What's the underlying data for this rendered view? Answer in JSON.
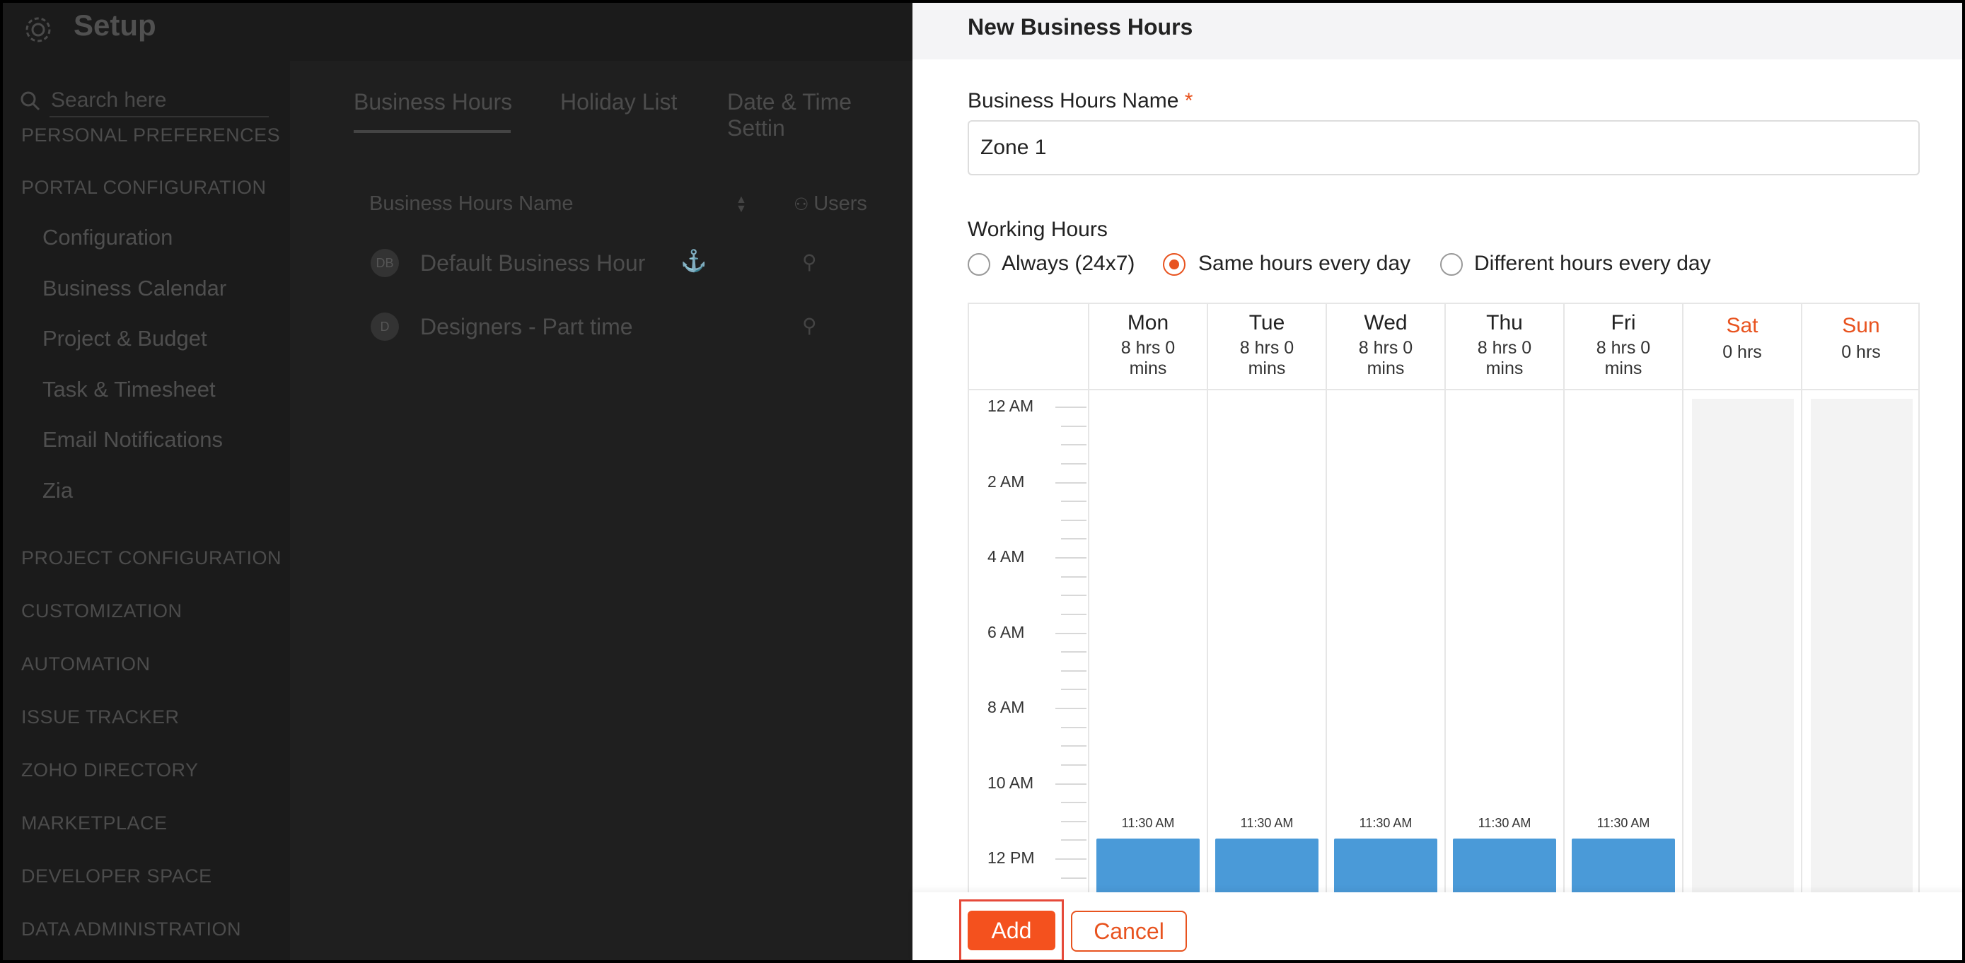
{
  "app": {
    "title": "Setup",
    "search_placeholder": "Search here",
    "sidebar": {
      "personal_preferences": "PERSONAL PREFERENCES",
      "portal_configuration": "PORTAL CONFIGURATION",
      "portal_items": [
        "Configuration",
        "Business Calendar",
        "Project & Budget",
        "Task & Timesheet",
        "Email Notifications",
        "Zia"
      ],
      "sections": [
        "PROJECT CONFIGURATION",
        "CUSTOMIZATION",
        "AUTOMATION",
        "ISSUE TRACKER",
        "ZOHO DIRECTORY",
        "MARKETPLACE",
        "DEVELOPER SPACE",
        "DATA ADMINISTRATION"
      ]
    },
    "tabs": [
      "Business Hours",
      "Holiday List",
      "Date & Time Settin"
    ],
    "table": {
      "headers": [
        "Business Hours Name",
        "Users"
      ],
      "rows": [
        {
          "avatar": "DB",
          "name": "Default Business Hour"
        },
        {
          "avatar": "D",
          "name": "Designers - Part time"
        }
      ]
    }
  },
  "drawer": {
    "title": "New Business Hours",
    "name_label": "Business Hours Name",
    "required_mark": "*",
    "name_value": "Zone 1",
    "working_hours_label": "Working Hours",
    "options": [
      {
        "label": "Always (24x7)",
        "selected": false
      },
      {
        "label": "Same hours every day",
        "selected": true
      },
      {
        "label": "Different hours every day",
        "selected": false
      }
    ],
    "days": [
      {
        "day": "Mon",
        "hours": "8 hrs 0",
        "hours2": "mins",
        "weekend": false,
        "start": "11:30 AM"
      },
      {
        "day": "Tue",
        "hours": "8 hrs 0",
        "hours2": "mins",
        "weekend": false,
        "start": "11:30 AM"
      },
      {
        "day": "Wed",
        "hours": "8 hrs 0",
        "hours2": "mins",
        "weekend": false,
        "start": "11:30 AM"
      },
      {
        "day": "Thu",
        "hours": "8 hrs 0",
        "hours2": "mins",
        "weekend": false,
        "start": "11:30 AM"
      },
      {
        "day": "Fri",
        "hours": "8 hrs 0",
        "hours2": "mins",
        "weekend": false,
        "start": "11:30 AM"
      },
      {
        "day": "Sat",
        "hours": "0 hrs",
        "hours2": "",
        "weekend": true,
        "start": ""
      },
      {
        "day": "Sun",
        "hours": "0 hrs",
        "hours2": "",
        "weekend": true,
        "start": ""
      }
    ],
    "time_labels": [
      "12 AM",
      "2 AM",
      "4 AM",
      "6 AM",
      "8 AM",
      "10 AM",
      "12 PM"
    ],
    "add_label": "Add",
    "cancel_label": "Cancel"
  },
  "colors": {
    "accent": "#f4511e",
    "block": "#4a9ad8",
    "overlay": "#222222"
  }
}
